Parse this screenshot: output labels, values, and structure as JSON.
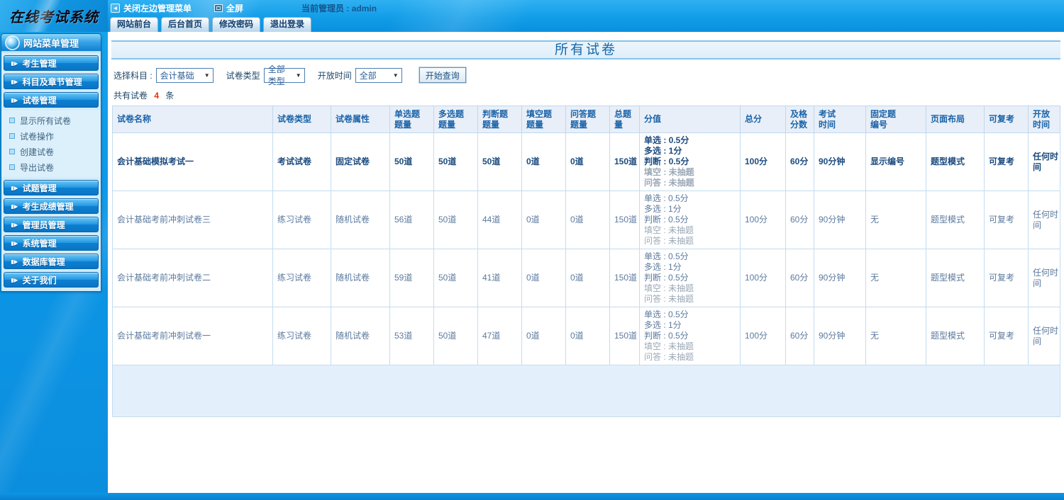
{
  "topbar": {
    "logo": "在线考试系统",
    "close_menu_label": "关闭左边管理菜单",
    "fullscreen_label": "全屏",
    "admin_label": "当前管理员 : admin",
    "tabs": [
      "网站前台",
      "后台首页",
      "修改密码",
      "退出登录"
    ]
  },
  "sidebar": {
    "title": "网站菜单管理",
    "menu": [
      {
        "label": "考生管理",
        "children": []
      },
      {
        "label": "科目及章节管理",
        "children": []
      },
      {
        "label": "试卷管理",
        "children": [
          "显示所有试卷",
          "试卷操作",
          "创建试卷",
          "导出试卷"
        ]
      },
      {
        "label": "试题管理",
        "children": []
      },
      {
        "label": "考生成绩管理",
        "children": []
      },
      {
        "label": "管理员管理",
        "children": []
      },
      {
        "label": "系统管理",
        "children": []
      },
      {
        "label": "数据库管理",
        "children": []
      },
      {
        "label": "关于我们",
        "children": []
      }
    ]
  },
  "main": {
    "title": "所有试卷",
    "filters": {
      "subject_label": "选择科目 :",
      "subject_value": "会计基础",
      "type_label": "试卷类型",
      "type_value": "全部类型",
      "time_label": "开放时间",
      "time_value": "全部",
      "search_button": "开始查询"
    },
    "summary_prefix": "共有试卷",
    "summary_count": "4",
    "summary_suffix": "条"
  },
  "table": {
    "columns": [
      "试卷名称",
      "试卷类型",
      "试卷属性",
      "单选题\n题量",
      "多选题\n题量",
      "判断题\n题量",
      "填空题\n题量",
      "问答题\n题量",
      "总题量",
      "分值",
      "总分",
      "及格\n分数",
      "考试\n时间",
      "固定题\n编号",
      "页面布局",
      "可复考",
      "开放时间"
    ],
    "rows": [
      {
        "bold": true,
        "cells": [
          "会计基础模拟考试一",
          "考试试卷",
          "固定试卷",
          "50道",
          "50道",
          "50道",
          "0道",
          "0道",
          "150道"
        ],
        "score_lines": [
          {
            "text": "单选 : 0.5分",
            "muted": false
          },
          {
            "text": "多选 : 1分",
            "muted": false
          },
          {
            "text": "判断 : 0.5分",
            "muted": false
          },
          {
            "text": "填空 : 未抽题",
            "muted": true
          },
          {
            "text": "问答 : 未抽题",
            "muted": true
          }
        ],
        "cells2": [
          "100分",
          "60分",
          "90分钟",
          "显示编号",
          "题型模式",
          "可复考"
        ],
        "open_time": "任何时间"
      },
      {
        "bold": false,
        "cells": [
          "会计基础考前冲刺试卷三",
          "练习试卷",
          "随机试卷",
          "56道",
          "50道",
          "44道",
          "0道",
          "0道",
          "150道"
        ],
        "score_lines": [
          {
            "text": "单选 : 0.5分",
            "muted": false
          },
          {
            "text": "多选 : 1分",
            "muted": false
          },
          {
            "text": "判断 : 0.5分",
            "muted": false
          },
          {
            "text": "填空 : 未抽题",
            "muted": true
          },
          {
            "text": "问答 : 未抽题",
            "muted": true
          }
        ],
        "cells2": [
          "100分",
          "60分",
          "90分钟",
          "无",
          "题型模式",
          "可复考"
        ],
        "open_time": "任何时间"
      },
      {
        "bold": false,
        "cells": [
          "会计基础考前冲刺试卷二",
          "练习试卷",
          "随机试卷",
          "59道",
          "50道",
          "41道",
          "0道",
          "0道",
          "150道"
        ],
        "score_lines": [
          {
            "text": "单选 : 0.5分",
            "muted": false
          },
          {
            "text": "多选 : 1分",
            "muted": false
          },
          {
            "text": "判断 : 0.5分",
            "muted": false
          },
          {
            "text": "填空 : 未抽题",
            "muted": true
          },
          {
            "text": "问答 : 未抽题",
            "muted": true
          }
        ],
        "cells2": [
          "100分",
          "60分",
          "90分钟",
          "无",
          "题型模式",
          "可复考"
        ],
        "open_time": "任何时间"
      },
      {
        "bold": false,
        "cells": [
          "会计基础考前冲刺试卷一",
          "练习试卷",
          "随机试卷",
          "53道",
          "50道",
          "47道",
          "0道",
          "0道",
          "150道"
        ],
        "score_lines": [
          {
            "text": "单选 : 0.5分",
            "muted": false
          },
          {
            "text": "多选 : 1分",
            "muted": false
          },
          {
            "text": "判断 : 0.5分",
            "muted": false
          },
          {
            "text": "填空 : 未抽题",
            "muted": true
          },
          {
            "text": "问答 : 未抽题",
            "muted": true
          }
        ],
        "cells2": [
          "100分",
          "60分",
          "90分钟",
          "无",
          "题型模式",
          "可复考"
        ],
        "open_time": "任何时间"
      }
    ]
  }
}
